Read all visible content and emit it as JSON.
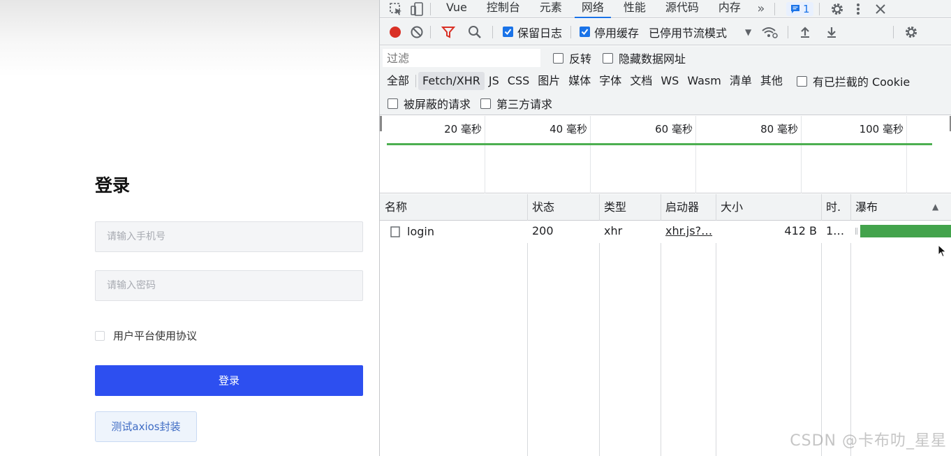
{
  "login": {
    "title": "登录",
    "phone_placeholder": "请输入手机号",
    "password_placeholder": "请输入密码",
    "agreement_label": "用户平台使用协议",
    "agreement_checked": false,
    "login_button": "登录",
    "axios_button": "测试axios封装"
  },
  "devtools": {
    "tabs": [
      "Vue",
      "控制台",
      "元素",
      "网络",
      "性能",
      "源代码",
      "内存"
    ],
    "active_tab": "网络",
    "message_badge": "1",
    "toolbar": {
      "preserve_log_label": "保留日志",
      "preserve_log_checked": true,
      "disable_cache_label": "停用缓存",
      "disable_cache_checked": true,
      "throttle_value": "已停用节流模式"
    },
    "filter": {
      "placeholder": "过滤",
      "invert_label": "反转",
      "hide_data_urls_label": "隐藏数据网址"
    },
    "types": [
      "全部",
      "Fetch/XHR",
      "JS",
      "CSS",
      "图片",
      "媒体",
      "字体",
      "文档",
      "WS",
      "Wasm",
      "清单",
      "其他"
    ],
    "active_type": "Fetch/XHR",
    "blocked_cookies_label": "有已拦截的 Cookie",
    "blocked_requests_label": "被屏蔽的请求",
    "third_party_label": "第三方请求",
    "overview_ticks": [
      "20 毫秒",
      "40 毫秒",
      "60 毫秒",
      "80 毫秒",
      "100 毫秒"
    ],
    "columns": [
      "名称",
      "状态",
      "类型",
      "启动器",
      "大小",
      "时.",
      "瀑布"
    ],
    "requests": [
      {
        "name": "login",
        "status": "200",
        "type": "xhr",
        "initiator": "xhr.js?…",
        "size": "412 B",
        "time": "1…"
      }
    ]
  },
  "watermark": "CSDN @卡布叻_星星",
  "colors": {
    "primary": "#2d4ff0",
    "devtools_accent": "#1a73e8",
    "record_red": "#d93025",
    "waterfall_green": "#43a34c"
  }
}
